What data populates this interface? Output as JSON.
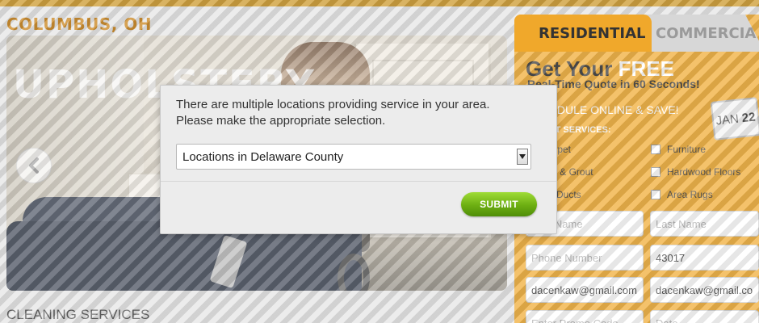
{
  "page": {
    "city_title": "COLUMBUS, OH",
    "section_title": "CLEANING SERVICES"
  },
  "hero": {
    "overlay_text": "UPHOLSTERY",
    "prev_icon": "chevron-left-icon"
  },
  "quote": {
    "tabs": [
      "RESIDENTIAL",
      "COMMERCIAL"
    ],
    "headline_prefix": "Get Your ",
    "headline_free": "FREE",
    "subheadline": "Real-Time Quote in 60 Seconds!",
    "schedule_text": "SCHEDULE ONLINE & SAVE!",
    "calendar_month": "JAN",
    "calendar_day": "22",
    "services_label": "SELECT SERVICES:",
    "services": [
      "Carpet",
      "Furniture",
      "Tile & Grout",
      "Hardwood Floors",
      "Air Ducts",
      "Area Rugs"
    ],
    "first_name_placeholder": "First Name",
    "last_name_placeholder": "Last Name",
    "phone_placeholder": "Phone Number",
    "zip_value": "43017",
    "email_value": "dacenkaw@gmail.com",
    "email_confirm_value": "dacenkaw@gmail.com",
    "promo_placeholder": "Enter Promo Code",
    "date_placeholder": "Date"
  },
  "modal": {
    "message_line1": "There are multiple locations providing service in your area.",
    "message_line2": "Please make the appropriate selection.",
    "selected_location": "Locations in Delaware County",
    "submit_label": "SUBMIT"
  },
  "colors": {
    "accent_orange": "#f0a82b",
    "city_title": "#c57a0a",
    "submit_green": "#6cae12"
  }
}
